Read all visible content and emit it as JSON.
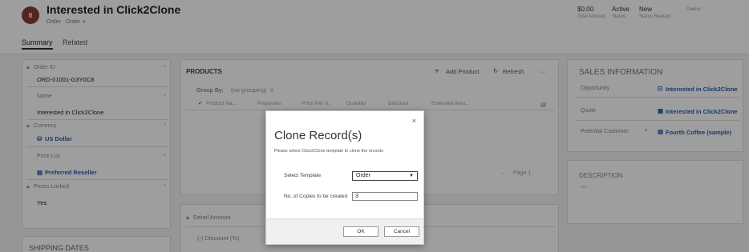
{
  "header": {
    "avatar_initials": "II",
    "title": "Interested in Click2Clone",
    "subtitle": "Order · Order ∨",
    "fields": [
      {
        "value": "$0.00",
        "label": "Total Amount"
      },
      {
        "value": "Active",
        "label": "Status"
      },
      {
        "value": "New",
        "label": "Status Reason"
      },
      {
        "value": "",
        "label": "Owner"
      }
    ],
    "tabs": [
      "Summary",
      "Related"
    ]
  },
  "summary": {
    "order_id_label": "Order ID",
    "order_id_value": "ORD-01001-G3Y0C8",
    "name_label": "Name",
    "name_value": "Interested in Click2Clone",
    "currency_label": "Currency",
    "currency_value": "US Dollar",
    "price_list_label": "Price List",
    "price_list_value": "Preferred Reseller",
    "prices_locked_label": "Prices Locked",
    "prices_locked_value": "Yes",
    "shipping_title": "SHIPPING DATES"
  },
  "products": {
    "title": "PRODUCTS",
    "add_product": "Add Product",
    "refresh": "Refresh",
    "more": "···",
    "group_by_label": "Group By:",
    "group_by_value": "(no grouping)",
    "columns": [
      "Product Na...",
      "Properties",
      "Price Per U...",
      "Quantity",
      "Discount",
      "Extended Amo..."
    ],
    "page_label": "Page 1",
    "detail_amount": "Detail Amount",
    "discount_label": "(-) Discount (%)"
  },
  "sales": {
    "title": "SALES INFORMATION",
    "rows": [
      {
        "label": "Opportunity",
        "value": "Interested in Click2Clone"
      },
      {
        "label": "Quote",
        "value": "Interested in Click2Clone"
      },
      {
        "label": "Potential Customer",
        "value": "Fourth Coffee (sample)"
      }
    ],
    "required_marker": "*",
    "description_title": "DESCRIPTION",
    "description_value": "---"
  },
  "modal": {
    "close": "×",
    "title": "Clone Record(s)",
    "description": "Please select Click2Clone template to clone the records",
    "template_label": "Select Template",
    "template_value": "Order",
    "copies_label": "No. of Copies to be created",
    "copies_value": "3",
    "ok_label": "OK",
    "cancel_label": "Cancel"
  }
}
